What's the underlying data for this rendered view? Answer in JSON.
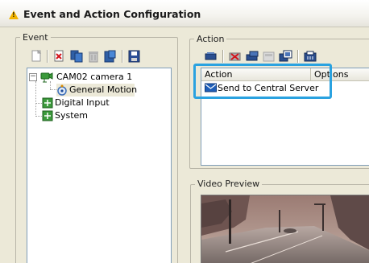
{
  "window": {
    "title": "Event and Action Configuration"
  },
  "event_panel": {
    "label": "Event",
    "toolbar_icons": [
      "new-icon",
      "delete-red-icon",
      "copy-icon",
      "trash-icon",
      "paste-icon",
      "save-icon"
    ],
    "tree": {
      "camera_node": "CAM02 camera 1",
      "general_motion": "General Motion",
      "digital_input": "Digital Input",
      "system": "System"
    }
  },
  "action_panel": {
    "label": "Action",
    "toolbar_icons": [
      "add-action-icon",
      "delete-action-icon",
      "edit-action-icon",
      "disabled-action-icon",
      "copy-action-icon",
      "test-action-icon"
    ],
    "columns": [
      "Action",
      "Options"
    ],
    "rows": [
      {
        "action": "Send to Central Server",
        "options": ""
      }
    ],
    "highlight_color": "#2aa2e0"
  },
  "video_preview": {
    "label": "Video Preview"
  }
}
